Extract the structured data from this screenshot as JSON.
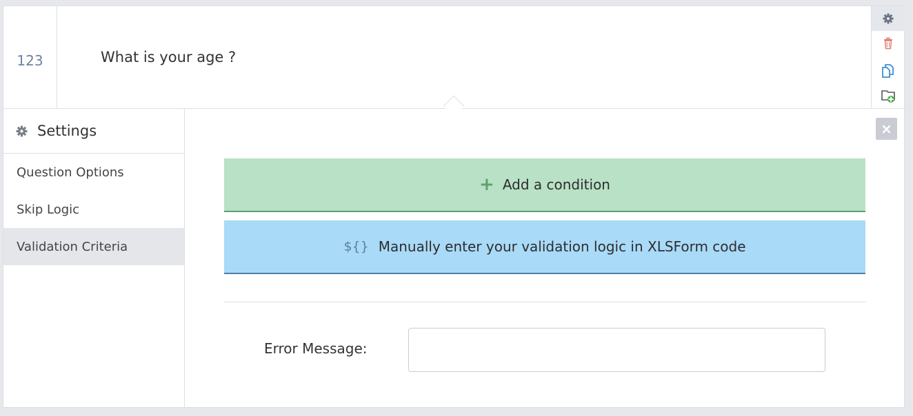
{
  "question": {
    "type_icon_text": "123",
    "label": "What is your age ?"
  },
  "tools": {
    "settings_icon": "gear-icon",
    "delete_icon": "trash-icon",
    "duplicate_icon": "duplicate-icon",
    "add_to_library_icon": "add-to-library-icon"
  },
  "settings": {
    "title": "Settings",
    "menu": [
      {
        "label": "Question Options"
      },
      {
        "label": "Skip Logic"
      },
      {
        "label": "Validation Criteria",
        "active": true
      }
    ]
  },
  "validation": {
    "add_condition_label": "Add a condition",
    "manual_prefix": "${}",
    "manual_label": "Manually enter your validation logic in XLSForm code",
    "error_message_label": "Error Message:",
    "error_message_value": "",
    "error_message_placeholder": ""
  },
  "colors": {
    "add_condition_bg": "#b9e1c6",
    "manual_bg": "#a9daf8",
    "delete_icon": "#e07a6f",
    "duplicate_icon": "#3d8fd6",
    "add_icon": "#4caf50"
  }
}
